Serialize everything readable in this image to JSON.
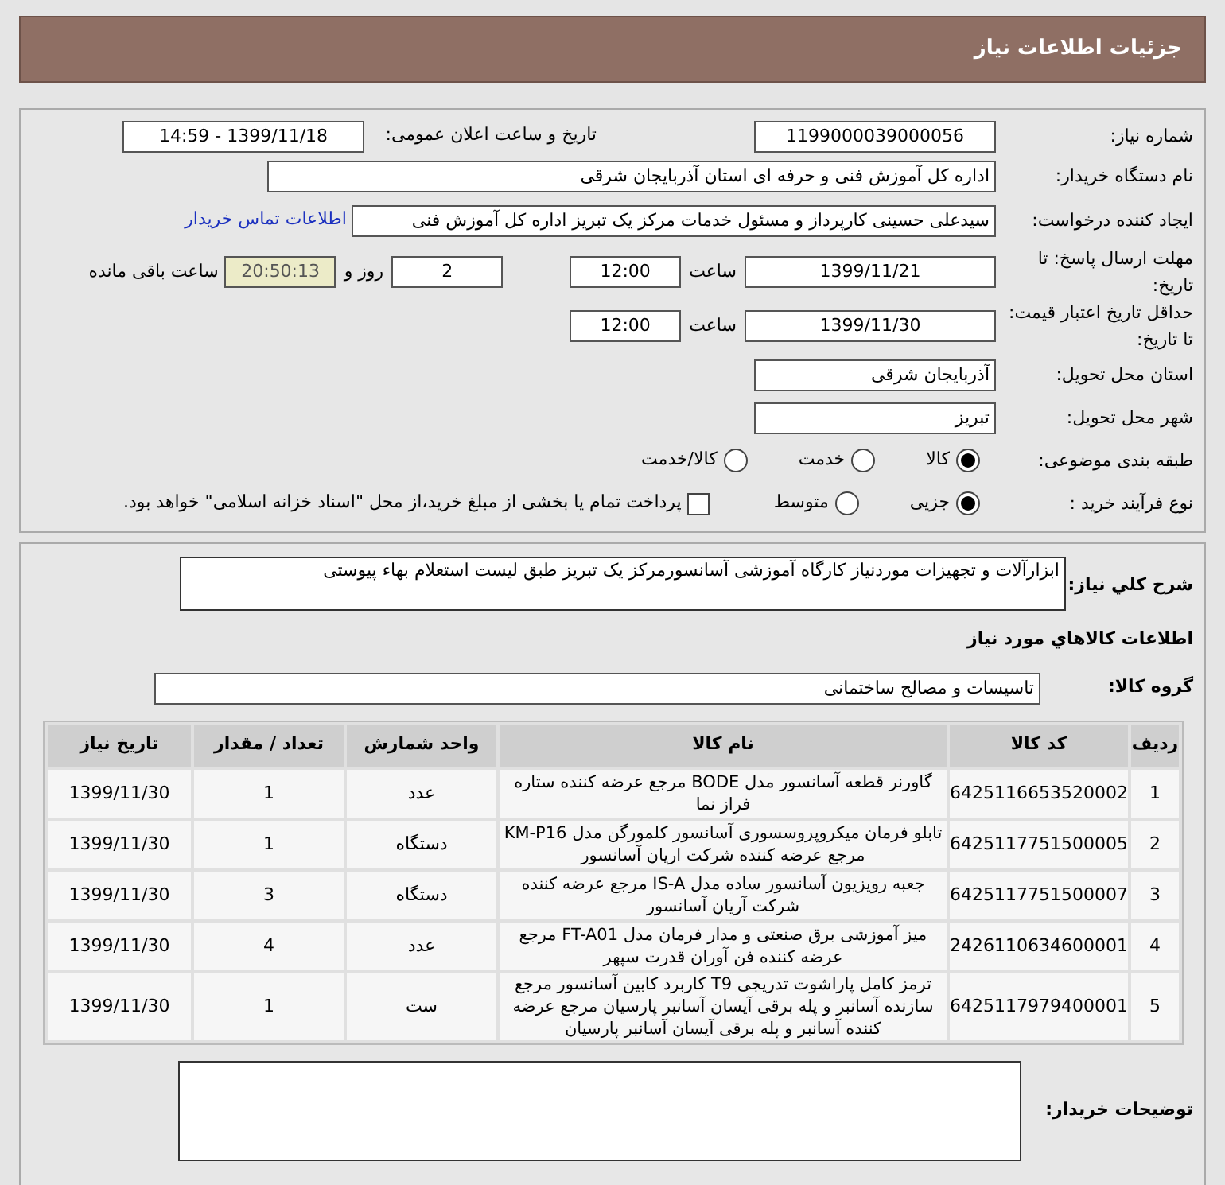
{
  "header": {
    "title": "جزئیات اطلاعات نیاز"
  },
  "need_number": {
    "label": "شماره نیاز:",
    "value": "1199000039000056"
  },
  "announce": {
    "label": "تاریخ و ساعت اعلان عمومی:",
    "value": "1399/11/18 - 14:59"
  },
  "buyer_org": {
    "label": "نام دستگاه خریدار:",
    "value": "اداره کل آموزش فنی و حرفه ای استان آذربایجان شرقی"
  },
  "requester": {
    "label": "ایجاد کننده درخواست:",
    "value": "سیدعلی حسینی کارپرداز و مسئول خدمات مرکز یک تبریز اداره کل آموزش فنی",
    "link": "اطلاعات تماس خریدار"
  },
  "deadline": {
    "label": "مهلت ارسال پاسخ: تا تاریخ:",
    "date": "1399/11/21",
    "time_label": "ساعت",
    "time": "12:00",
    "days": "2",
    "days_label": "روز و",
    "remaining": "20:50:13",
    "remaining_label": "ساعت باقی مانده"
  },
  "validity": {
    "label": "حداقل تاریخ اعتبار قیمت: تا تاریخ:",
    "date": "1399/11/30",
    "time_label": "ساعت",
    "time": "12:00"
  },
  "province": {
    "label": "استان محل تحویل:",
    "value": "آذربایجان شرقی"
  },
  "city": {
    "label": "شهر محل تحویل:",
    "value": "تبریز"
  },
  "category": {
    "label": "طبقه بندی موضوعی:",
    "options": [
      {
        "label": "کالا",
        "selected": true
      },
      {
        "label": "خدمت",
        "selected": false
      },
      {
        "label": "کالا/خدمت",
        "selected": false
      }
    ]
  },
  "process": {
    "label": "نوع فرآیند خرید :",
    "options": [
      {
        "label": "جزیی",
        "selected": true
      },
      {
        "label": "متوسط",
        "selected": false
      }
    ],
    "payment": {
      "label": "پرداخت تمام یا بخشی از مبلغ خرید،از محل \"اسناد خزانه اسلامی\" خواهد بود.",
      "checked": false
    }
  },
  "description": {
    "label": "شرح کلي نياز:",
    "value": "ابزارآلات و تجهیزات موردنیاز کارگاه آموزشی آسانسورمرکز یک تبریز طبق لیست استعلام بهاء پیوستی"
  },
  "goods_title": "اطلاعات کالاهاي مورد نياز",
  "group": {
    "label": "گروه کالا:",
    "value": "تاسیسات و مصالح ساختمانی"
  },
  "table": {
    "columns": [
      "ردیف",
      "کد کالا",
      "نام کالا",
      "واحد شمارش",
      "تعداد / مقدار",
      "تاریخ نیاز"
    ],
    "rows": [
      [
        "1",
        "6425116653520002",
        "گاورنر قطعه آسانسور مدل BODE مرجع عرضه کننده ستاره فراز نما",
        "عدد",
        "1",
        "1399/11/30"
      ],
      [
        "2",
        "6425117751500005",
        "تابلو فرمان میکروپروسسوری آسانسور کلمورگن مدل KM-P16 مرجع عرضه کننده شرکت اریان آسانسور",
        "دستگاه",
        "1",
        "1399/11/30"
      ],
      [
        "3",
        "6425117751500007",
        "جعبه رویزیون آسانسور ساده مدل IS-A مرجع عرضه کننده شرکت آریان آسانسور",
        "دستگاه",
        "3",
        "1399/11/30"
      ],
      [
        "4",
        "2426110634600001",
        "میز آموزشی برق صنعتی و مدار فرمان مدل FT-A01 مرجع عرضه کننده فن آوران قدرت سپهر",
        "عدد",
        "4",
        "1399/11/30"
      ],
      [
        "5",
        "6425117979400001",
        "ترمز کامل پاراشوت تدریجی T9 کاربرد کابین آسانسور مرجع سازنده آسانبر و پله برقی آیسان آسانبر پارسیان مرجع عرضه کننده آسانبر و پله برقی آیسان آسانبر پارسیان",
        "ست",
        "1",
        "1399/11/30"
      ]
    ]
  },
  "buyer_notes": {
    "label": "توضیحات خریدار:"
  }
}
